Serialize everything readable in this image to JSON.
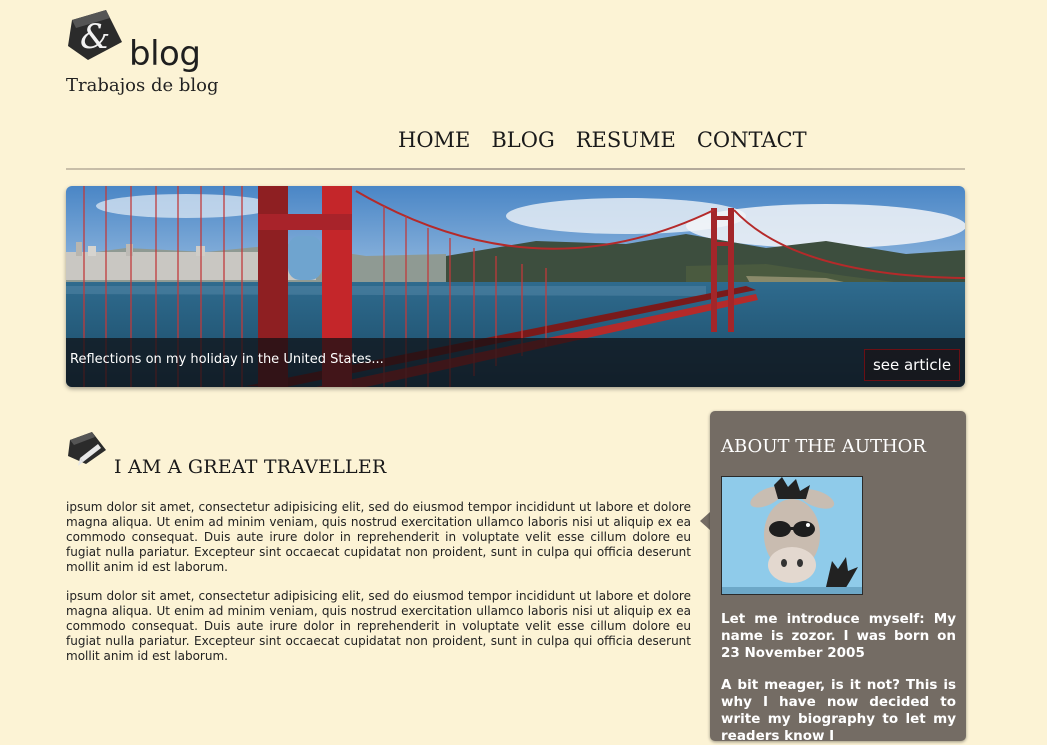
{
  "site": {
    "logo_text": "blog",
    "tagline": "Trabajos de blog"
  },
  "nav": {
    "items": [
      "HOME",
      "BLOG",
      "RESUME",
      "CONTACT"
    ]
  },
  "banner": {
    "caption": "Reflections on my holiday in the United States...",
    "button_label": "see article"
  },
  "post": {
    "title": "I AM A GREAT TRAVELLER",
    "paragraphs": [
      "ipsum dolor sit amet, consectetur adipisicing elit, sed do eiusmod tempor incididunt ut labore et dolore magna aliqua. Ut enim ad minim veniam, quis nostrud exercitation ullamco laboris nisi ut aliquip ex ea commodo consequat. Duis aute irure dolor in reprehenderit in voluptate velit esse cillum dolore eu fugiat nulla pariatur. Excepteur sint occaecat cupidatat non proident, sunt in culpa qui officia deserunt mollit anim id est laborum.",
      "ipsum dolor sit amet, consectetur adipisicing elit, sed do eiusmod tempor incididunt ut labore et dolore magna aliqua. Ut enim ad minim veniam, quis nostrud exercitation ullamco laboris nisi ut aliquip ex ea commodo consequat. Duis aute irure dolor in reprehenderit in voluptate velit esse cillum dolore eu fugiat nulla pariatur. Excepteur sint occaecat cupidatat non proident, sunt in culpa qui officia deserunt mollit anim id est laborum."
    ]
  },
  "sidebar": {
    "title": "ABOUT THE AUTHOR",
    "paragraphs": [
      "Let me introduce myself: My name is zozor. I was born on 23 November 2005",
      "A bit meager, is it not? This is why I have now decided to write my biography to let my readers know I"
    ]
  },
  "icons": {
    "logo": "zozor-logo-icon",
    "post": "pen-icon"
  },
  "colors": {
    "background": "#fcf3d5",
    "sidebar": "#746c64",
    "button_border": "#6b0f14"
  }
}
